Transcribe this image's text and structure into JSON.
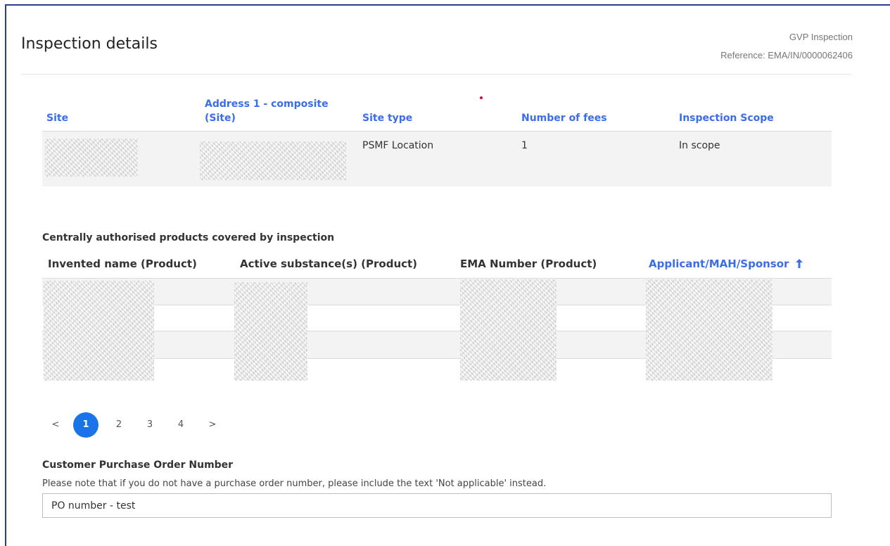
{
  "header": {
    "title": "Inspection details",
    "inspection_type": "GVP Inspection",
    "reference": "Reference: EMA/IN/0000062406"
  },
  "site_table": {
    "columns": [
      "Site",
      "Address 1 - composite (Site)",
      "Site type",
      "Number of fees",
      "Inspection Scope"
    ],
    "rows": [
      {
        "site_type": "PSMF Location",
        "number_of_fees": "1",
        "inspection_scope": "In scope"
      }
    ]
  },
  "products": {
    "caption": "Centrally authorised products covered by inspection",
    "columns": [
      "Invented name (Product)",
      "Active substance(s) (Product)",
      "EMA Number (Product)",
      "Applicant/MAH/Sponsor"
    ],
    "sort_icon": "arrow-up-icon"
  },
  "pagination": {
    "prev": "<",
    "pages": [
      "1",
      "2",
      "3",
      "4"
    ],
    "next": ">",
    "active_page": "1"
  },
  "purchase_order": {
    "label": "Customer Purchase Order Number",
    "note": "Please note that if you do not have a purchase order number, please include the text 'Not applicable' instead.",
    "value": "PO number - test"
  },
  "colors": {
    "accent": "#1a73e8",
    "header_link": "#3a6ee8",
    "frame": "#2a3e8c"
  }
}
